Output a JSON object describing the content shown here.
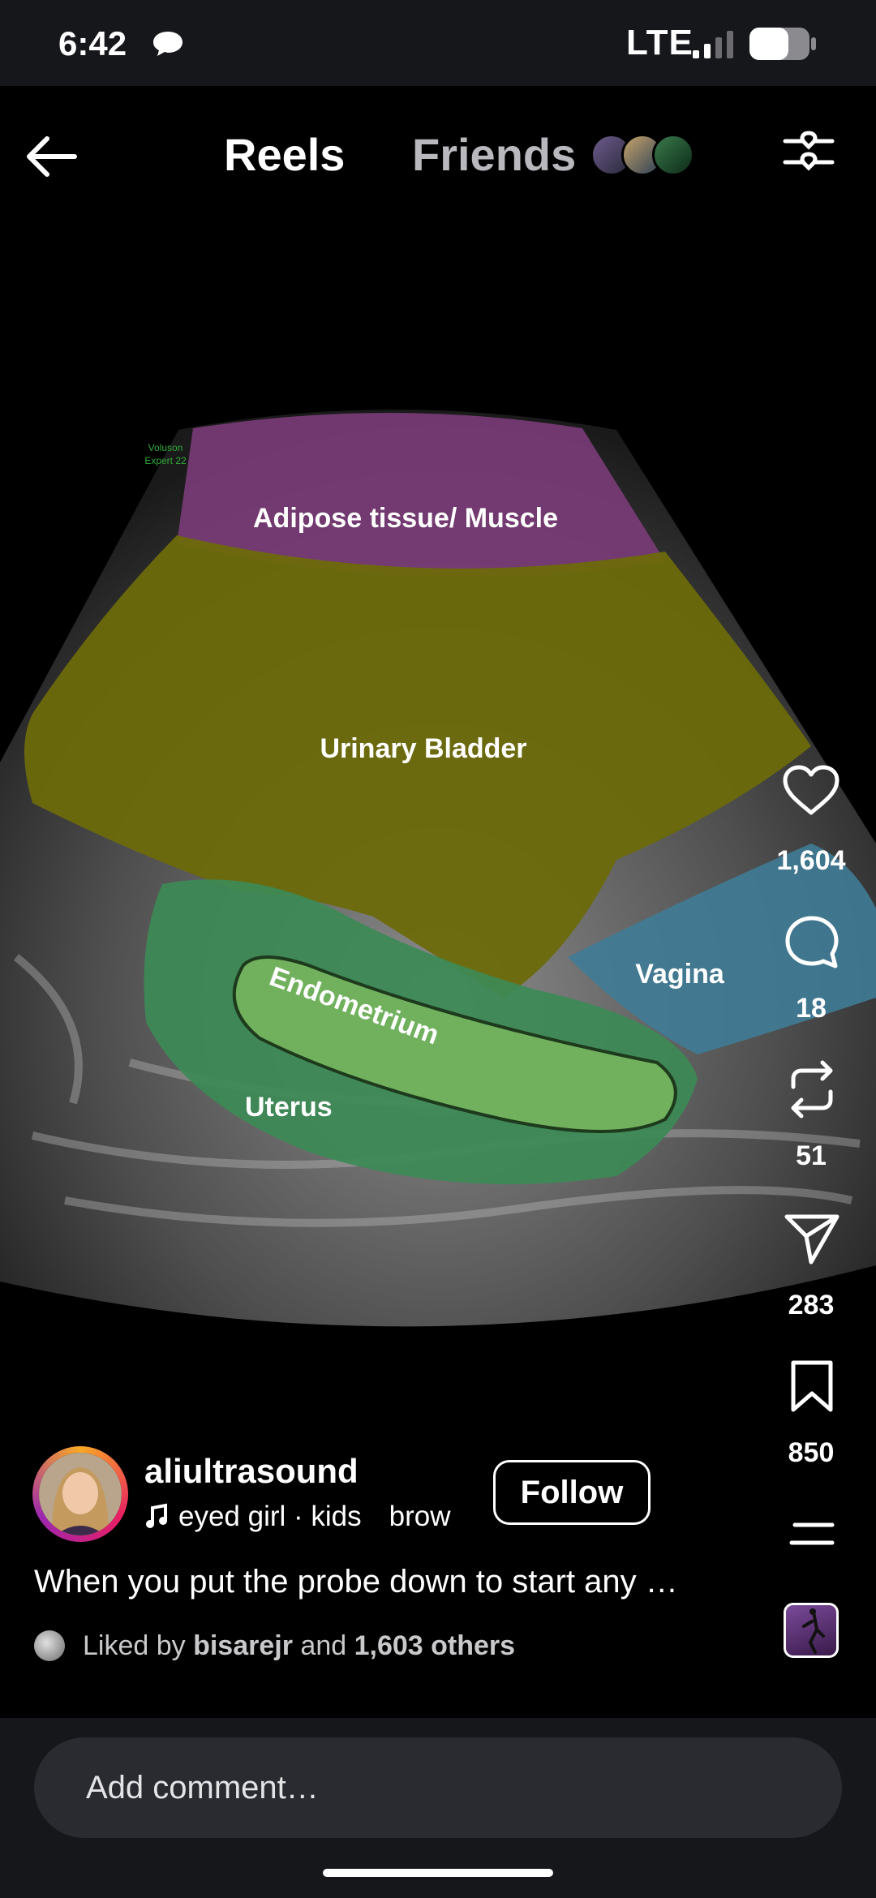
{
  "status_bar": {
    "time": "6:42",
    "network": "LTE"
  },
  "header": {
    "tab_reels": "Reels",
    "tab_friends": "Friends"
  },
  "media": {
    "watermark": [
      "Voluson",
      "Expert 22"
    ],
    "labels": {
      "adipose": "Adipose tissue/ Muscle",
      "bladder": "Urinary Bladder",
      "vagina": "Vagina",
      "endometrium": "Endometrium",
      "uterus": "Uterus"
    },
    "colors": {
      "adipose": "#7a3c78",
      "bladder": "#6d6a0b",
      "vagina": "#3f7c96",
      "uterus": "#3d8a56",
      "endometrium": "#74b35e"
    }
  },
  "actions": {
    "likes": "1,604",
    "comments": "18",
    "reposts": "51",
    "shares": "283",
    "saves": "850"
  },
  "post": {
    "username": "aliultrasound",
    "audio": "eyed girl · kids",
    "audio_extra": "brow",
    "follow_label": "Follow",
    "caption": "When you put the probe down to start any …",
    "liked_prefix": "Liked by",
    "liked_user": "bisarejr",
    "liked_and": "and",
    "liked_others": "1,603 others"
  },
  "comment": {
    "placeholder": "Add comment…"
  }
}
